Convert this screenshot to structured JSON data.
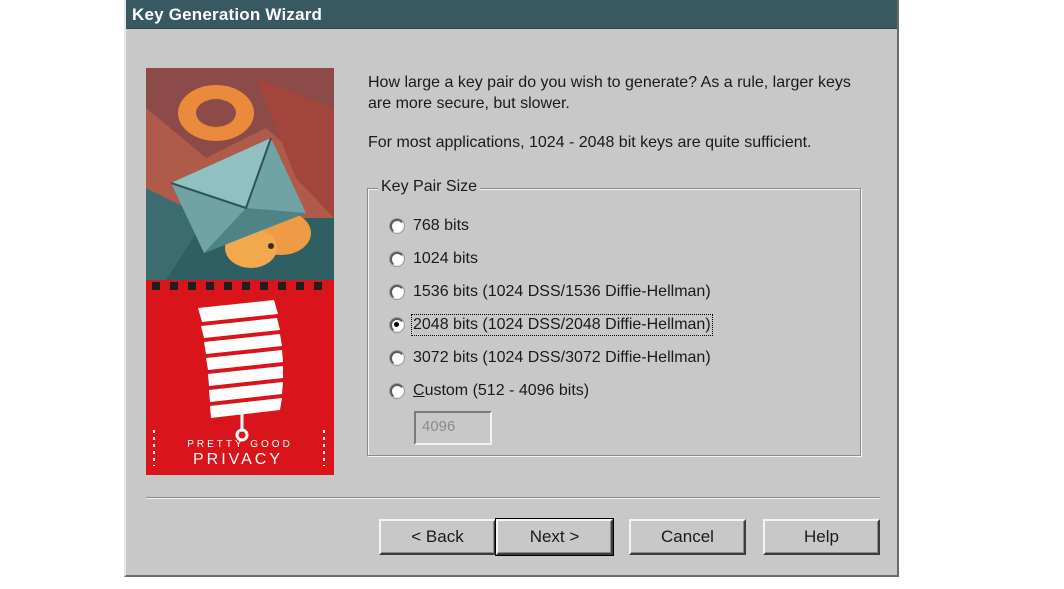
{
  "window": {
    "title": "Key Generation Wizard"
  },
  "artwork": {
    "logo_line1": "PRETTY GOOD",
    "logo_line2": "PRIVACY"
  },
  "content": {
    "prompt": "How large a key pair do you wish to generate?  As a rule, larger keys are more secure, but slower.",
    "hint": "For most applications, 1024 - 2048 bit keys are quite sufficient."
  },
  "key_pair_size": {
    "legend": "Key Pair Size",
    "options": [
      {
        "label": "768 bits",
        "checked": false
      },
      {
        "label": "1024 bits",
        "checked": false
      },
      {
        "label": "1536 bits (1024 DSS/1536 Diffie-Hellman)",
        "checked": false
      },
      {
        "label": "2048 bits (1024 DSS/2048 Diffie-Hellman)",
        "checked": true
      },
      {
        "label": "3072 bits (1024 DSS/3072 Diffie-Hellman)",
        "checked": false
      },
      {
        "label": "Custom (512 - 4096 bits)",
        "checked": false
      }
    ],
    "custom_value": "4096"
  },
  "buttons": {
    "back": "< Back",
    "next": "Next >",
    "cancel": "Cancel",
    "help": "Help"
  },
  "colors": {
    "titlebar": "#385862",
    "dialog_bg": "#c8c8c8",
    "logo_red": "#d9141a"
  }
}
